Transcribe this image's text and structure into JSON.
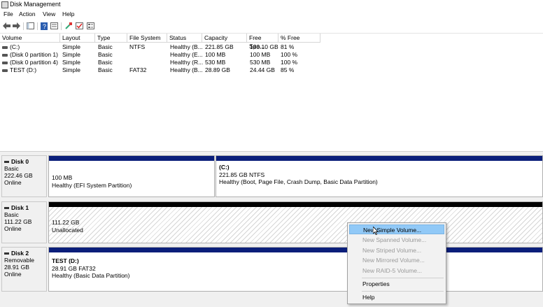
{
  "window": {
    "title": "Disk Management"
  },
  "menu": [
    "File",
    "Action",
    "View",
    "Help"
  ],
  "toolbar_icons": [
    "back-arrow-icon",
    "forward-arrow-icon",
    "console-tree-icon",
    "help-icon",
    "properties-icon",
    "rescan-icon",
    "check-icon",
    "list-icon"
  ],
  "volume_list": {
    "headers": [
      "Volume",
      "Layout",
      "Type",
      "File System",
      "Status",
      "Capacity",
      "Free Spa...",
      "% Free"
    ],
    "rows": [
      [
        "(C:)",
        "Simple",
        "Basic",
        "NTFS",
        "Healthy (B...",
        "221.85 GB",
        "180.10 GB",
        "81 %"
      ],
      [
        "(Disk 0 partition 1)",
        "Simple",
        "Basic",
        "",
        "Healthy (E...",
        "100 MB",
        "100 MB",
        "100 %"
      ],
      [
        "(Disk 0 partition 4)",
        "Simple",
        "Basic",
        "",
        "Healthy (R...",
        "530 MB",
        "530 MB",
        "100 %"
      ],
      [
        "TEST (D:)",
        "Simple",
        "Basic",
        "FAT32",
        "Healthy (B...",
        "28.89 GB",
        "24.44 GB",
        "85 %"
      ]
    ]
  },
  "disks": [
    {
      "name": "Disk 0",
      "type": "Basic",
      "size": "222.46 GB",
      "status": "Online",
      "partitions": [
        {
          "name": "",
          "line1": "100 MB",
          "line2": "Healthy (EFI System Partition)"
        },
        {
          "name": "(C:)",
          "line1": "221.85 GB NTFS",
          "line2": "Healthy (Boot, Page File, Crash Dump, Basic Data Partition)"
        }
      ]
    },
    {
      "name": "Disk 1",
      "type": "Basic",
      "size": "111.22 GB",
      "status": "Online",
      "partitions": [
        {
          "name": "",
          "line1": "111.22 GB",
          "line2": "Unallocated"
        }
      ]
    },
    {
      "name": "Disk 2",
      "type": "Removable",
      "size": "28.91 GB",
      "status": "Online",
      "partitions": [
        {
          "name": "TEST  (D:)",
          "line1": "28.91 GB FAT32",
          "line2": "Healthy (Basic Data Partition)"
        }
      ]
    }
  ],
  "context_menu": {
    "items": [
      {
        "label": "New Simple Volume...",
        "enabled": true,
        "highlighted": true
      },
      {
        "label": "New Spanned Volume...",
        "enabled": false
      },
      {
        "label": "New Striped Volume...",
        "enabled": false
      },
      {
        "label": "New Mirrored Volume...",
        "enabled": false
      },
      {
        "label": "New RAID-5 Volume...",
        "enabled": false
      },
      {
        "label": "Properties",
        "enabled": true
      },
      {
        "label": "Help",
        "enabled": true
      }
    ]
  },
  "colors": {
    "partition_bar": "#0a1e7a",
    "unallocated_bar": "#000000",
    "menu_highlight": "#91c9f7"
  }
}
